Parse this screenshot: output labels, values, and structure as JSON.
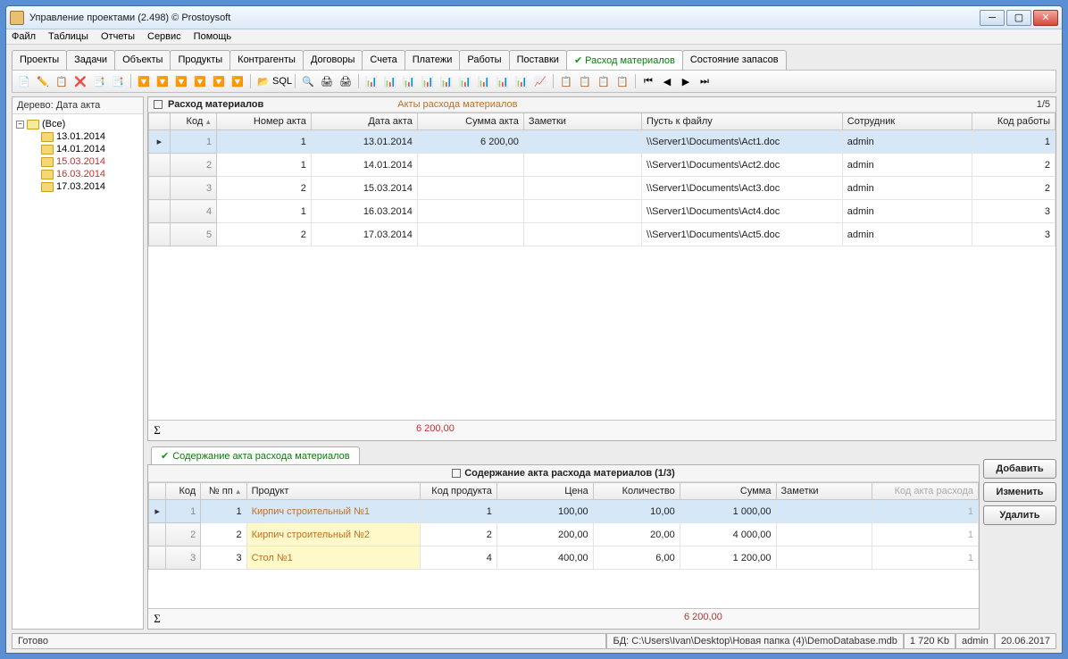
{
  "window": {
    "title": "Управление проектами (2.498) © Prostoysoft"
  },
  "menu": [
    "Файл",
    "Таблицы",
    "Отчеты",
    "Сервис",
    "Помощь"
  ],
  "tabs": {
    "items": [
      "Проекты",
      "Задачи",
      "Объекты",
      "Продукты",
      "Контрагенты",
      "Договоры",
      "Счета",
      "Платежи",
      "Работы",
      "Поставки",
      "Расход материалов",
      "Состояние запасов"
    ],
    "active_index": 10
  },
  "tree": {
    "header": "Дерево: Дата акта",
    "root": "(Все)",
    "items": [
      {
        "label": "13.01.2014",
        "red": false
      },
      {
        "label": "14.01.2014",
        "red": false
      },
      {
        "label": "15.03.2014",
        "red": true
      },
      {
        "label": "16.03.2014",
        "red": true
      },
      {
        "label": "17.03.2014",
        "red": false
      }
    ]
  },
  "grid1": {
    "title": "Расход материалов",
    "subtitle": "Акты расхода материалов",
    "pager": "1/5",
    "columns": [
      "Код",
      "Номер акта",
      "Дата акта",
      "Сумма акта",
      "Заметки",
      "Пусть к файлу",
      "Сотрудник",
      "Код работы"
    ],
    "rows": [
      {
        "idx": "1",
        "sel": true,
        "kod": "1",
        "nomer": "1",
        "data": "13.01.2014",
        "summa": "6 200,00",
        "zam": "",
        "path": "\\\\Server1\\Documents\\Act1.doc",
        "sotr": "admin",
        "kr": "1"
      },
      {
        "idx": "2",
        "sel": false,
        "kod": "",
        "nomer": "1",
        "data": "14.01.2014",
        "summa": "",
        "zam": "",
        "path": "\\\\Server1\\Documents\\Act2.doc",
        "sotr": "admin",
        "kr": "2"
      },
      {
        "idx": "3",
        "sel": false,
        "kod": "",
        "nomer": "2",
        "data": "15.03.2014",
        "summa": "",
        "zam": "",
        "path": "\\\\Server1\\Documents\\Act3.doc",
        "sotr": "admin",
        "kr": "2"
      },
      {
        "idx": "4",
        "sel": false,
        "kod": "",
        "nomer": "1",
        "data": "16.03.2014",
        "summa": "",
        "zam": "",
        "path": "\\\\Server1\\Documents\\Act4.doc",
        "sotr": "admin",
        "kr": "3"
      },
      {
        "idx": "5",
        "sel": false,
        "kod": "",
        "nomer": "2",
        "data": "17.03.2014",
        "summa": "",
        "zam": "",
        "path": "\\\\Server1\\Documents\\Act5.doc",
        "sotr": "admin",
        "kr": "3"
      }
    ],
    "sum": "6 200,00"
  },
  "subtab": "Содержание акта расхода материалов",
  "grid2": {
    "title": "Содержание акта расхода материалов (1/3)",
    "columns": [
      "Код",
      "№ пп",
      "Продукт",
      "Код продукта",
      "Цена",
      "Количество",
      "Сумма",
      "Заметки",
      "Код акта расхода"
    ],
    "rows": [
      {
        "idx": "1",
        "sel": true,
        "npp": "1",
        "prod": "Кирпич строительный №1",
        "hl": false,
        "kp": "1",
        "cena": "100,00",
        "kol": "10,00",
        "summa": "1 000,00",
        "zam": "",
        "kar": "1"
      },
      {
        "idx": "2",
        "sel": false,
        "npp": "2",
        "prod": "Кирпич строительный №2",
        "hl": true,
        "kp": "2",
        "cena": "200,00",
        "kol": "20,00",
        "summa": "4 000,00",
        "zam": "",
        "kar": "1"
      },
      {
        "idx": "3",
        "sel": false,
        "npp": "3",
        "prod": "Стол №1",
        "hl": true,
        "kp": "4",
        "cena": "400,00",
        "kol": "6,00",
        "summa": "1 200,00",
        "zam": "",
        "kar": "1"
      }
    ],
    "sum": "6 200,00"
  },
  "buttons": {
    "add": "Добавить",
    "edit": "Изменить",
    "del": "Удалить"
  },
  "status": {
    "ready": "Готово",
    "db_label": "БД:",
    "db_path": "C:\\Users\\Ivan\\Desktop\\Новая папка (4)\\DemoDatabase.mdb",
    "size": "1 720 Kb",
    "user": "admin",
    "date": "20.06.2017"
  },
  "toolbar_icons": [
    "📄",
    "✏️",
    "📋",
    "❌",
    "📑",
    "📑",
    "|",
    "🔽",
    "🔽",
    "🔽",
    "🔽",
    "🔽",
    "🔽",
    "|",
    "📂",
    "SQL",
    "|",
    "🔍",
    "🖨",
    "🖨",
    "|",
    "📊",
    "📊",
    "📊",
    "📊",
    "📊",
    "📊",
    "📊",
    "📊",
    "📊",
    "📈",
    "|",
    "📋",
    "📋",
    "📋",
    "📋",
    "|",
    "⏮",
    "◀",
    "▶",
    "⏭"
  ]
}
